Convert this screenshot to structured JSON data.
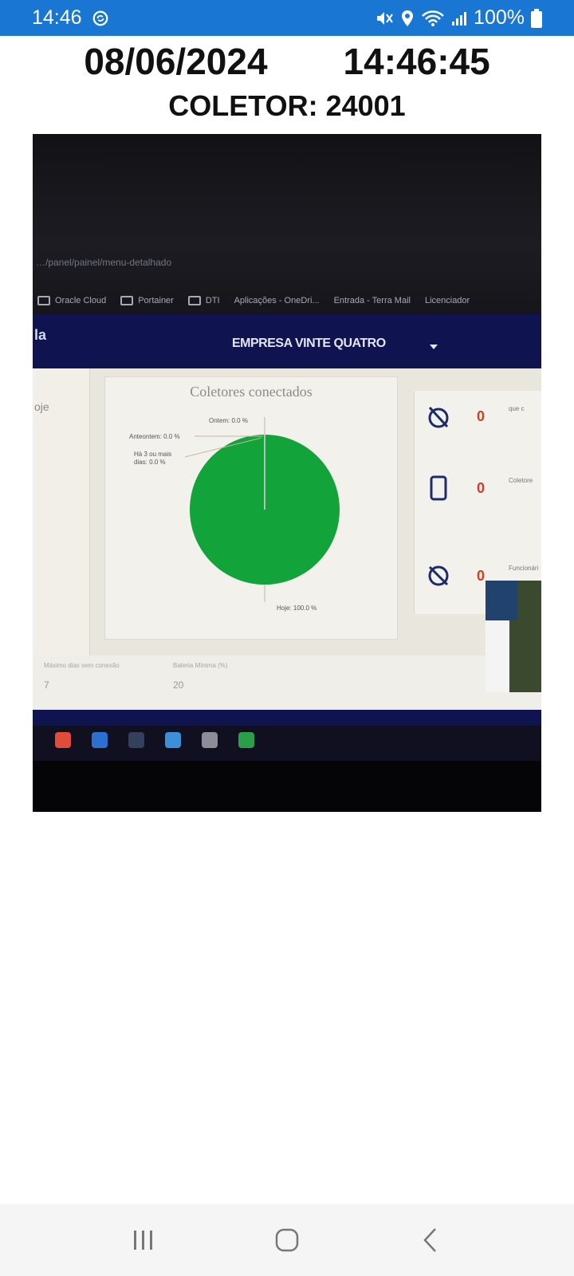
{
  "status_bar": {
    "time": "14:46",
    "battery": "100%",
    "icons": [
      "sync-icon",
      "mute-icon",
      "location-icon",
      "wifi-icon",
      "signal-icon",
      "battery-icon"
    ]
  },
  "header": {
    "date": "08/06/2024",
    "time": "14:46:45",
    "collector": "COLETOR: 24001"
  },
  "photo_content": {
    "bookmarks": [
      "Oracle Cloud",
      "Portainer",
      "DTI",
      "Aplicações - OneDri...",
      "Entrada - Terra Mail",
      "Licenciador"
    ],
    "company": "EMPRESA VINTE QUATRO",
    "chart_title": "Coletores conectados",
    "chart_labels": {
      "ontem": "Ontem: 0.0 %",
      "anteontem": "Anteontem: 0.0 %",
      "tres_dias_1": "Há 3 ou mais",
      "tres_dias_2": "dias: 0.0 %",
      "hoje": "Hoje: 100.0 %"
    },
    "kpis": [
      {
        "value": "0",
        "text": "que c"
      },
      {
        "value": "0",
        "text": "Coletore"
      },
      {
        "value": "0",
        "text": "Funcionári"
      }
    ]
  },
  "chart_data": {
    "type": "pie",
    "title": "Coletores conectados",
    "categories": [
      "Hoje",
      "Ontem",
      "Anteontem",
      "Há 3 ou mais dias"
    ],
    "values": [
      100.0,
      0.0,
      0.0,
      0.0
    ],
    "colors": [
      "#12a33a",
      "#e6c48c",
      "#c9c9c9",
      "#bdbdbd"
    ]
  },
  "colors": {
    "status_bar": "#1976d2",
    "pie_green": "#12a33a",
    "app_bar": "#0f1450",
    "kpi_red": "#d93b2b"
  }
}
